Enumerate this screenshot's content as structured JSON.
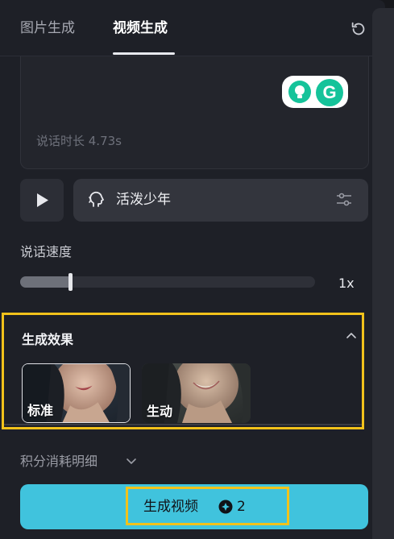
{
  "tabs": [
    {
      "label": "图片生成",
      "active": false
    },
    {
      "label": "视频生成",
      "active": true
    }
  ],
  "audio": {
    "duration_text": "说话时长 4.73s"
  },
  "voice": {
    "name": "活泼少年"
  },
  "speed": {
    "label": "说话速度",
    "value_text": "1x",
    "level_fraction": 0.17
  },
  "effect": {
    "title": "生成效果",
    "options": [
      {
        "label": "标准",
        "selected": true
      },
      {
        "label": "生动",
        "selected": false
      }
    ]
  },
  "credits": {
    "label": "积分消耗明细"
  },
  "generate": {
    "label": "生成视频",
    "cost": "2"
  },
  "colors": {
    "accent": "#40c3dd",
    "highlight": "#f2c21b",
    "panel": "#1e2027"
  },
  "icons": [
    "refresh-icon",
    "play-icon",
    "voice-head-icon",
    "settings-sliders-icon",
    "chevron-up-icon",
    "chevron-down-icon",
    "coin-icon",
    "grammarly-icon"
  ]
}
